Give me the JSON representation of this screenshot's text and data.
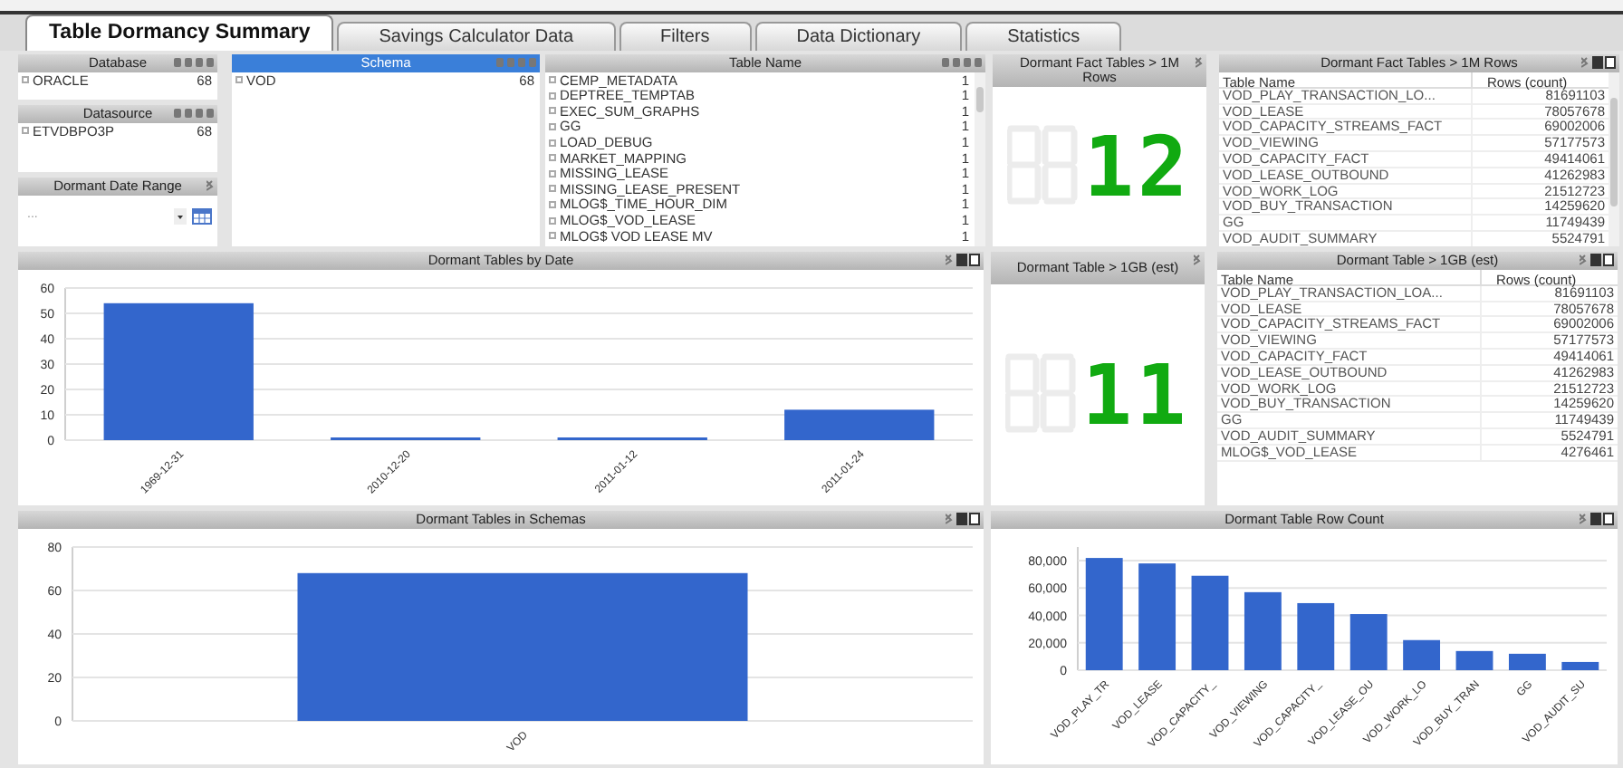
{
  "tabs": [
    {
      "label": "Table Dormancy Summary",
      "selected": true
    },
    {
      "label": "Savings Calculator Data",
      "selected": false
    },
    {
      "label": "Filters",
      "selected": false
    },
    {
      "label": "Data Dictionary",
      "selected": false
    },
    {
      "label": "Statistics",
      "selected": false
    }
  ],
  "database": {
    "title": "Database",
    "active": false,
    "items": [
      {
        "label": "ORACLE",
        "count": "68"
      }
    ]
  },
  "datasource": {
    "title": "Datasource",
    "active": false,
    "items": [
      {
        "label": "ETVDBPO3P",
        "count": "68"
      }
    ]
  },
  "date_range": {
    "title": "Dormant Date Range",
    "value": "..."
  },
  "schema": {
    "title": "Schema",
    "active": true,
    "items": [
      {
        "label": "VOD",
        "count": "68"
      }
    ]
  },
  "table_name": {
    "title": "Table Name",
    "active": false,
    "items": [
      {
        "label": "CEMP_METADATA",
        "count": "1"
      },
      {
        "label": "DEPTREE_TEMPTAB",
        "count": "1"
      },
      {
        "label": "EXEC_SUM_GRAPHS",
        "count": "1"
      },
      {
        "label": "GG",
        "count": "1"
      },
      {
        "label": "LOAD_DEBUG",
        "count": "1"
      },
      {
        "label": "MARKET_MAPPING",
        "count": "1"
      },
      {
        "label": "MISSING_LEASE",
        "count": "1"
      },
      {
        "label": "MISSING_LEASE_PRESENT",
        "count": "1"
      },
      {
        "label": "MLOG$_TIME_HOUR_DIM",
        "count": "1"
      },
      {
        "label": "MLOG$_VOD_LEASE",
        "count": "1"
      },
      {
        "label": "MLOG$ VOD LEASE MV",
        "count": "1"
      }
    ]
  },
  "led_panels": [
    {
      "title": "Dormant Fact Tables > 1M Rows",
      "value": "12"
    },
    {
      "title": "Dormant Table > 1GB (est)",
      "value": "11"
    }
  ],
  "tables": [
    {
      "title": "Dormant Fact Tables > 1M Rows",
      "columns": [
        "Table Name",
        "Rows (count)"
      ],
      "rows": [
        [
          "VOD_PLAY_TRANSACTION_LO...",
          "81691103"
        ],
        [
          "VOD_LEASE",
          "78057678"
        ],
        [
          "VOD_CAPACITY_STREAMS_FACT",
          "69002006"
        ],
        [
          "VOD_VIEWING",
          "57177573"
        ],
        [
          "VOD_CAPACITY_FACT",
          "49414061"
        ],
        [
          "VOD_LEASE_OUTBOUND",
          "41262983"
        ],
        [
          "VOD_WORK_LOG",
          "21512723"
        ],
        [
          "VOD_BUY_TRANSACTION",
          "14259620"
        ],
        [
          "GG",
          "11749439"
        ],
        [
          "VOD_AUDIT_SUMMARY",
          "5524791"
        ]
      ]
    },
    {
      "title": "Dormant Table > 1GB (est)",
      "columns": [
        "Table Name",
        "Rows (count)"
      ],
      "rows": [
        [
          "VOD_PLAY_TRANSACTION_LOA...",
          "81691103"
        ],
        [
          "VOD_LEASE",
          "78057678"
        ],
        [
          "VOD_CAPACITY_STREAMS_FACT",
          "69002006"
        ],
        [
          "VOD_VIEWING",
          "57177573"
        ],
        [
          "VOD_CAPACITY_FACT",
          "49414061"
        ],
        [
          "VOD_LEASE_OUTBOUND",
          "41262983"
        ],
        [
          "VOD_WORK_LOG",
          "21512723"
        ],
        [
          "VOD_BUY_TRANSACTION",
          "14259620"
        ],
        [
          "GG",
          "11749439"
        ],
        [
          "VOD_AUDIT_SUMMARY",
          "5524791"
        ],
        [
          "MLOG$_VOD_LEASE",
          "4276461"
        ]
      ]
    }
  ],
  "charts": [
    {
      "chart_data": {
        "type": "bar",
        "title": "Dormant Tables by Date",
        "categories": [
          "1969-12-31",
          "2010-12-20",
          "2011-01-12",
          "2011-01-24"
        ],
        "values": [
          54,
          1,
          1,
          12
        ],
        "grid": true,
        "ylim": [
          0,
          60
        ],
        "yticks": [
          0,
          10,
          20,
          30,
          40,
          50,
          60
        ]
      }
    },
    {
      "chart_data": {
        "type": "bar",
        "title": "Dormant Tables in Schemas",
        "categories": [
          "VOD"
        ],
        "values": [
          68
        ],
        "grid": true,
        "ylim": [
          0,
          80
        ],
        "yticks": [
          0,
          20,
          40,
          60,
          80
        ]
      }
    },
    {
      "chart_data": {
        "type": "bar",
        "title": "Dormant Table Row Count",
        "categories": [
          "VOD_PLAY_TR",
          "VOD_LEASE",
          "VOD_CAPACITY_",
          "VOD_VIEWING",
          "VOD_CAPACITY_",
          "VOD_LEASE_OU",
          "VOD_WORK_LO",
          "VOD_BUY_TRAN",
          "GG",
          "VOD_AUDIT_SU"
        ],
        "values": [
          82000,
          78000,
          69000,
          57000,
          49000,
          41000,
          22000,
          14000,
          12000,
          6000
        ],
        "grid": true,
        "ylim": [
          0,
          90000
        ],
        "yticks": [
          0,
          {
            "value": 20000,
            "label": "20,000"
          },
          {
            "value": 40000,
            "label": "40,000"
          },
          {
            "value": 60000,
            "label": "60,000"
          },
          {
            "value": 80000,
            "label": "80,000"
          }
        ]
      }
    }
  ]
}
